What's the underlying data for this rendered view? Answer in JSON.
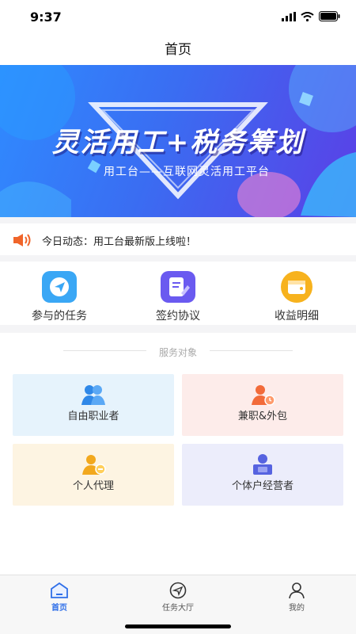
{
  "status": {
    "time": "9:37"
  },
  "header": {
    "title": "首页"
  },
  "banner": {
    "title": "灵活用工+税务筹划",
    "subtitle": "用工台——互联网灵活用工平台"
  },
  "notice": {
    "text": "今日动态：用工台最新版上线啦！"
  },
  "quick_actions": [
    {
      "label": "参与的任务",
      "icon": "send-icon",
      "color": "#3aa7f5"
    },
    {
      "label": "签约协议",
      "icon": "contract-icon",
      "color": "#6a5af0"
    },
    {
      "label": "收益明细",
      "icon": "wallet-icon",
      "color": "#f7b21d"
    }
  ],
  "service": {
    "heading": "服务对象",
    "cards": [
      {
        "label": "自由职业者",
        "icon": "freelancer-icon",
        "bg": "#e6f3fc",
        "color": "#2f88e8"
      },
      {
        "label": "兼职&外包",
        "icon": "parttime-icon",
        "bg": "#fdecea",
        "color": "#f26b3a"
      },
      {
        "label": "个人代理",
        "icon": "agent-icon",
        "bg": "#fdf4e2",
        "color": "#f2a81d"
      },
      {
        "label": "个体户经营者",
        "icon": "business-icon",
        "bg": "#ecedfb",
        "color": "#5663e0"
      }
    ]
  },
  "tabs": [
    {
      "label": "首页",
      "icon": "home-icon",
      "active": true
    },
    {
      "label": "任务大厅",
      "icon": "task-hall-icon",
      "active": false
    },
    {
      "label": "我的",
      "icon": "profile-icon",
      "active": false
    }
  ]
}
